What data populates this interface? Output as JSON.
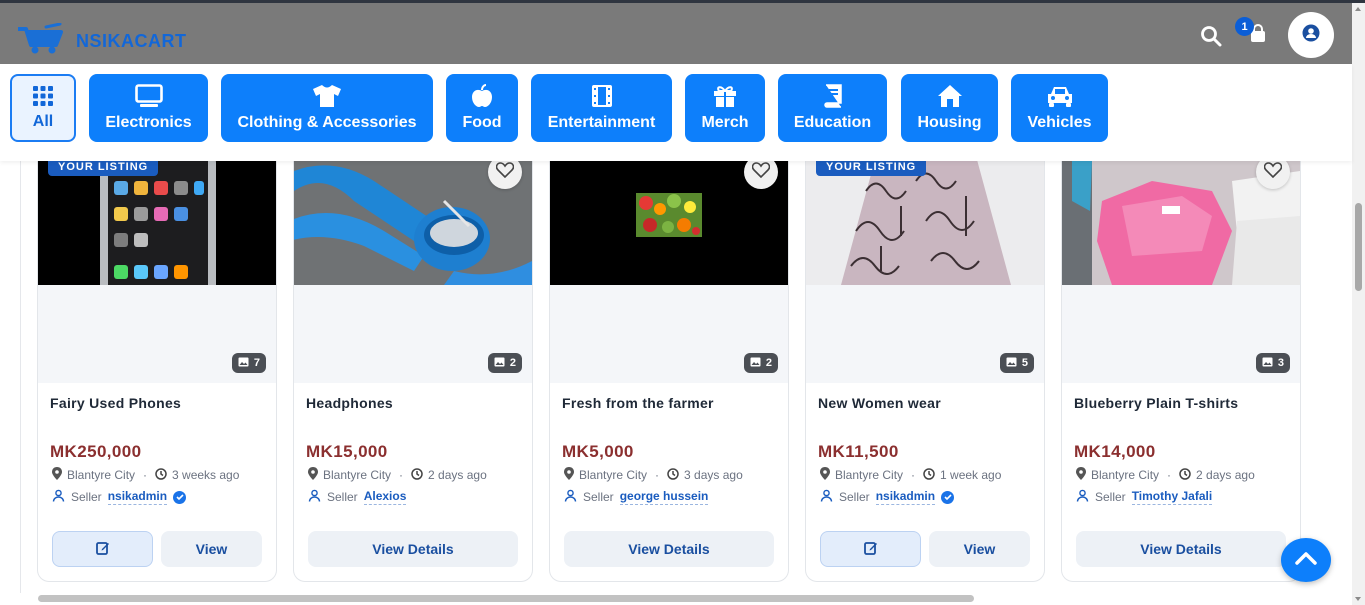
{
  "app": {
    "name": "NSIKACART",
    "cart_count": "1"
  },
  "categories": [
    {
      "label": "All",
      "icon": "grid-icon"
    },
    {
      "label": "Electronics",
      "icon": "monitor-icon"
    },
    {
      "label": "Clothing & Accessories",
      "icon": "shirt-icon"
    },
    {
      "label": "Food",
      "icon": "apple-icon"
    },
    {
      "label": "Entertainment",
      "icon": "film-icon"
    },
    {
      "label": "Merch",
      "icon": "gift-icon"
    },
    {
      "label": "Education",
      "icon": "book-icon"
    },
    {
      "label": "Housing",
      "icon": "house-icon"
    },
    {
      "label": "Vehicles",
      "icon": "car-icon"
    }
  ],
  "listing_badge": "YOUR LISTING",
  "seller_label": "Seller",
  "products": [
    {
      "title": "Fairy Used Phones",
      "price": "MK250,000",
      "location": "Blantyre City",
      "posted": "3 weeks ago",
      "seller": "nsikadmin",
      "verified": true,
      "images": "7",
      "own_listing": true,
      "edit_label": "",
      "view_label": "View"
    },
    {
      "title": "Headphones",
      "price": "MK15,000",
      "location": "Blantyre City",
      "posted": "2 days ago",
      "seller": "Alexios",
      "verified": false,
      "images": "2",
      "own_listing": false,
      "details_label": "View Details"
    },
    {
      "title": "Fresh from the farmer",
      "price": "MK5,000",
      "location": "Blantyre City",
      "posted": "3 days ago",
      "seller": "george hussein",
      "verified": false,
      "images": "2",
      "own_listing": false,
      "details_label": "View Details"
    },
    {
      "title": "New Women wear",
      "price": "MK11,500",
      "location": "Blantyre City",
      "posted": "1 week ago",
      "seller": "nsikadmin",
      "verified": true,
      "images": "5",
      "own_listing": true,
      "view_label": "View"
    },
    {
      "title": "Blueberry Plain T-shirts",
      "price": "MK14,000",
      "location": "Blantyre City",
      "posted": "2 days ago",
      "seller": "Timothy Jafali",
      "verified": false,
      "images": "3",
      "own_listing": false,
      "details_label": "View Details"
    }
  ],
  "colors": {
    "brand": "#0d7ffb",
    "price": "#8b2f2f",
    "header_bg": "#7a7a7a"
  }
}
